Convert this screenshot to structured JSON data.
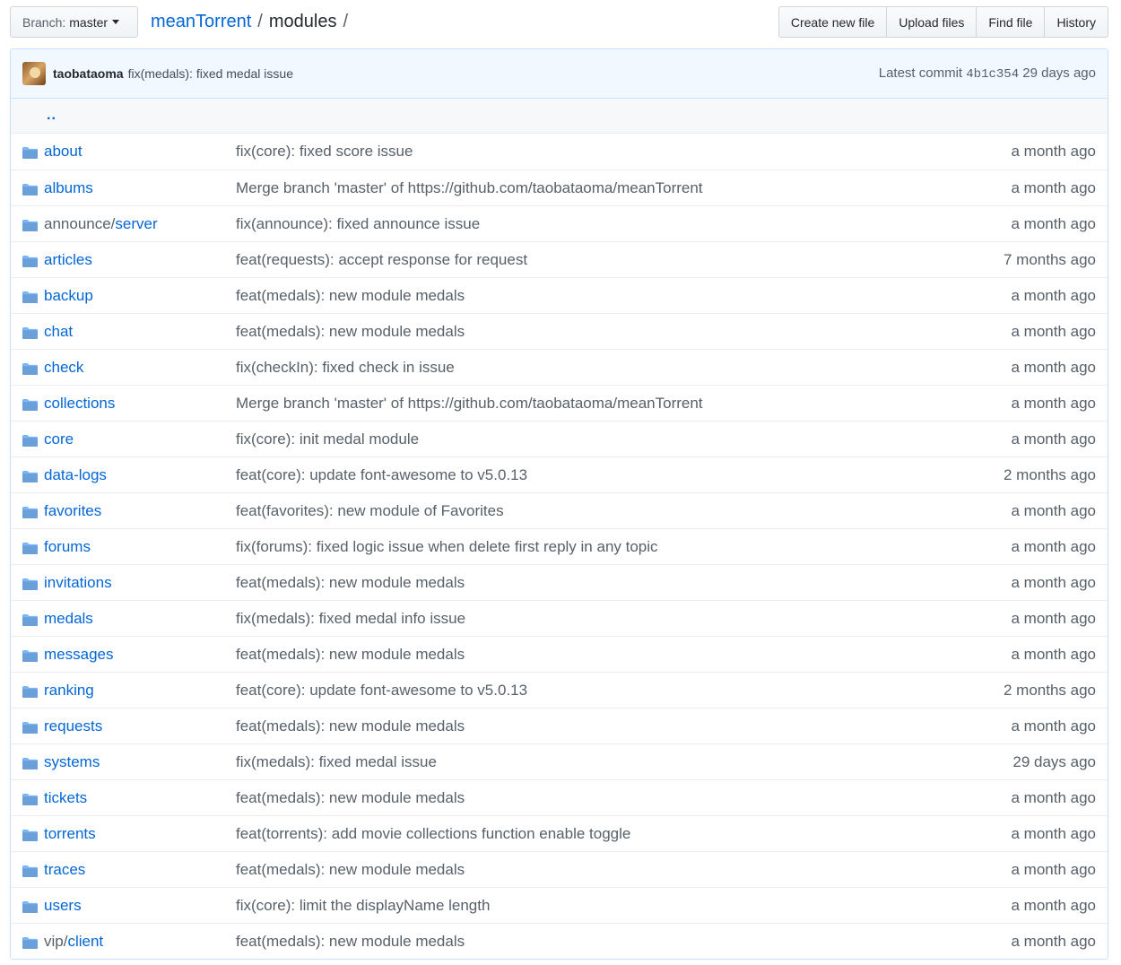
{
  "branch": {
    "label": "Branch:",
    "name": "master"
  },
  "breadcrumb": {
    "repo": "meanTorrent",
    "separator": "/",
    "current": "modules",
    "trailing": "/"
  },
  "actions": [
    "Create new file",
    "Upload files",
    "Find file",
    "History"
  ],
  "commit": {
    "author": "taobataoma",
    "message": "fix(medals): fixed medal issue",
    "latest_label": "Latest commit",
    "sha": "4b1c354",
    "age": "29 days ago"
  },
  "parent_link": "..",
  "rows": [
    {
      "dim": "",
      "name": "about",
      "msg": "fix(core): fixed score issue",
      "age": "a month ago"
    },
    {
      "dim": "",
      "name": "albums",
      "msg": "Merge branch 'master' of https://github.com/taobataoma/meanTorrent",
      "age": "a month ago"
    },
    {
      "dim": "announce/",
      "name": "server",
      "msg": "fix(announce): fixed announce issue",
      "age": "a month ago"
    },
    {
      "dim": "",
      "name": "articles",
      "msg": "feat(requests): accept response for request",
      "age": "7 months ago"
    },
    {
      "dim": "",
      "name": "backup",
      "msg": "feat(medals): new module medals",
      "age": "a month ago"
    },
    {
      "dim": "",
      "name": "chat",
      "msg": "feat(medals): new module medals",
      "age": "a month ago"
    },
    {
      "dim": "",
      "name": "check",
      "msg": "fix(checkIn): fixed check in issue",
      "age": "a month ago"
    },
    {
      "dim": "",
      "name": "collections",
      "msg": "Merge branch 'master' of https://github.com/taobataoma/meanTorrent",
      "age": "a month ago"
    },
    {
      "dim": "",
      "name": "core",
      "msg": "fix(core): init medal module",
      "age": "a month ago"
    },
    {
      "dim": "",
      "name": "data-logs",
      "msg": "feat(core): update font-awesome to v5.0.13",
      "age": "2 months ago"
    },
    {
      "dim": "",
      "name": "favorites",
      "msg": "feat(favorites): new module of Favorites",
      "age": "a month ago"
    },
    {
      "dim": "",
      "name": "forums",
      "msg": "fix(forums): fixed logic issue when delete first reply in any topic",
      "age": "a month ago"
    },
    {
      "dim": "",
      "name": "invitations",
      "msg": "feat(medals): new module medals",
      "age": "a month ago"
    },
    {
      "dim": "",
      "name": "medals",
      "msg": "fix(medals): fixed medal info issue",
      "age": "a month ago"
    },
    {
      "dim": "",
      "name": "messages",
      "msg": "feat(medals): new module medals",
      "age": "a month ago"
    },
    {
      "dim": "",
      "name": "ranking",
      "msg": "feat(core): update font-awesome to v5.0.13",
      "age": "2 months ago"
    },
    {
      "dim": "",
      "name": "requests",
      "msg": "feat(medals): new module medals",
      "age": "a month ago"
    },
    {
      "dim": "",
      "name": "systems",
      "msg": "fix(medals): fixed medal issue",
      "age": "29 days ago"
    },
    {
      "dim": "",
      "name": "tickets",
      "msg": "feat(medals): new module medals",
      "age": "a month ago"
    },
    {
      "dim": "",
      "name": "torrents",
      "msg": "feat(torrents): add movie collections function enable toggle",
      "age": "a month ago"
    },
    {
      "dim": "",
      "name": "traces",
      "msg": "feat(medals): new module medals",
      "age": "a month ago"
    },
    {
      "dim": "",
      "name": "users",
      "msg": "fix(core): limit the displayName length",
      "age": "a month ago"
    },
    {
      "dim": "vip/",
      "name": "client",
      "msg": "feat(medals): new module medals",
      "age": "a month ago"
    }
  ]
}
